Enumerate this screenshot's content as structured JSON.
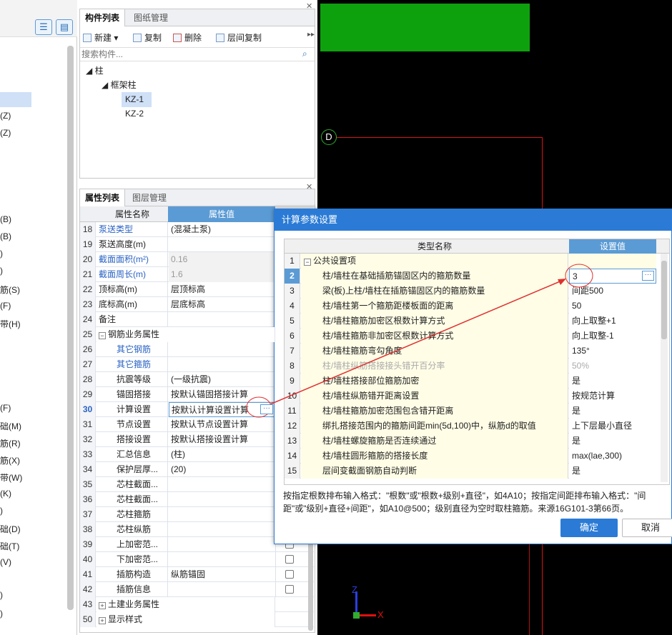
{
  "left_strip": {
    "items": [
      "(Z)",
      "(Z)",
      "(B)",
      "(B)",
      ")",
      ")",
      "筋(S)",
      "(F)",
      "带(H)",
      "(F)",
      "础(M)",
      "筋(R)",
      "筋(X)",
      "带(W)",
      "(K)",
      ")",
      "础(D)",
      "础(T)",
      "(V)",
      ")",
      ")"
    ]
  },
  "component_panel": {
    "tabs": [
      "构件列表",
      "图纸管理"
    ],
    "toolbar": {
      "new": "新建",
      "copy": "复制",
      "delete": "删除",
      "floor_copy": "层间复制"
    },
    "search_placeholder": "搜索构件...",
    "tree": {
      "root": "柱",
      "category": "框架柱",
      "items": [
        "KZ-1",
        "KZ-2"
      ]
    }
  },
  "property_panel": {
    "tabs": [
      "属性列表",
      "图层管理"
    ],
    "headers": {
      "name": "属性名称",
      "value": "属性值"
    },
    "rows": [
      {
        "num": "18",
        "name": "泵送类型",
        "value": "(混凝土泵)"
      },
      {
        "num": "19",
        "name": "泵送高度(m)",
        "value": ""
      },
      {
        "num": "20",
        "name": "截面面积(m²)",
        "value": "0.16"
      },
      {
        "num": "21",
        "name": "截面周长(m)",
        "value": "1.6"
      },
      {
        "num": "22",
        "name": "顶标高(m)",
        "value": "层顶标高"
      },
      {
        "num": "23",
        "name": "底标高(m)",
        "value": "层底标高"
      },
      {
        "num": "24",
        "name": "备注",
        "value": ""
      },
      {
        "num": "25",
        "name": "钢筋业务属性",
        "value": ""
      },
      {
        "num": "26",
        "name": "其它钢筋",
        "value": ""
      },
      {
        "num": "27",
        "name": "其它箍筋",
        "value": ""
      },
      {
        "num": "28",
        "name": "抗震等级",
        "value": "(一级抗震)"
      },
      {
        "num": "29",
        "name": "锚固搭接",
        "value": "按默认锚固搭接计算"
      },
      {
        "num": "30",
        "name": "计算设置",
        "value": "按默认计算设置计算"
      },
      {
        "num": "31",
        "name": "节点设置",
        "value": "按默认节点设置计算"
      },
      {
        "num": "32",
        "name": "搭接设置",
        "value": "按默认搭接设置计算"
      },
      {
        "num": "33",
        "name": "汇总信息",
        "value": "(柱)"
      },
      {
        "num": "34",
        "name": "保护层厚...",
        "value": "(20)"
      },
      {
        "num": "35",
        "name": "芯柱截面...",
        "value": ""
      },
      {
        "num": "36",
        "name": "芯柱截面...",
        "value": ""
      },
      {
        "num": "37",
        "name": "芯柱箍筋",
        "value": ""
      },
      {
        "num": "38",
        "name": "芯柱纵筋",
        "value": ""
      },
      {
        "num": "39",
        "name": "上加密范...",
        "value": ""
      },
      {
        "num": "40",
        "name": "下加密范...",
        "value": ""
      },
      {
        "num": "41",
        "name": "插筋构造",
        "value": "纵筋锚固"
      },
      {
        "num": "42",
        "name": "插筋信息",
        "value": ""
      },
      {
        "num": "43",
        "name": "土建业务属性",
        "value": ""
      },
      {
        "num": "50",
        "name": "显示样式",
        "value": ""
      }
    ]
  },
  "canvas": {
    "axis_label": "D",
    "x_axis": "X",
    "z_axis": "Z"
  },
  "dialog": {
    "title": "计算参数设置",
    "headers": {
      "name": "类型名称",
      "value": "设置值"
    },
    "group": "公共设置项",
    "rows": [
      {
        "num": "2",
        "name": "柱/墙柱在基础插筋锚固区内的箍筋数量",
        "value": "3"
      },
      {
        "num": "3",
        "name": "梁(板)上柱/墙柱在插筋锚固区内的箍筋数量",
        "value": "间距500"
      },
      {
        "num": "4",
        "name": "柱/墙柱第一个箍筋距楼板面的距离",
        "value": "50"
      },
      {
        "num": "5",
        "name": "柱/墙柱箍筋加密区根数计算方式",
        "value": "向上取整+1"
      },
      {
        "num": "6",
        "name": "柱/墙柱箍筋非加密区根数计算方式",
        "value": "向上取整-1"
      },
      {
        "num": "7",
        "name": "柱/墙柱箍筋弯勾角度",
        "value": "135°"
      },
      {
        "num": "8",
        "name": "柱/墙柱纵筋搭接接头错开百分率",
        "value": "50%"
      },
      {
        "num": "9",
        "name": "柱/墙柱搭接部位箍筋加密",
        "value": "是"
      },
      {
        "num": "10",
        "name": "柱/墙柱纵筋错开距离设置",
        "value": "按规范计算"
      },
      {
        "num": "11",
        "name": "柱/墙柱箍筋加密范围包含错开距离",
        "value": "是"
      },
      {
        "num": "12",
        "name": "绑扎搭接范围内的箍筋间距min(5d,100)中，纵筋d的取值",
        "value": "上下层最小直径"
      },
      {
        "num": "13",
        "name": "柱/墙柱螺旋箍筋是否连续通过",
        "value": "是"
      },
      {
        "num": "14",
        "name": "柱/墙柱圆形箍筋的搭接长度",
        "value": "max(lae,300)"
      },
      {
        "num": "15",
        "name": "层间变截面钢筋自动判断",
        "value": "是"
      }
    ],
    "description": "按指定根数排布输入格式：\"根数\"或\"根数+级别+直径\"，如4A10；按指定间距排布输入格式：\"间距\"或\"级别+直径+间距\"，如A10@500；级别直径为空时取柱箍筋。来源16G101-3第66页。",
    "ok": "确定",
    "cancel": "取消"
  }
}
